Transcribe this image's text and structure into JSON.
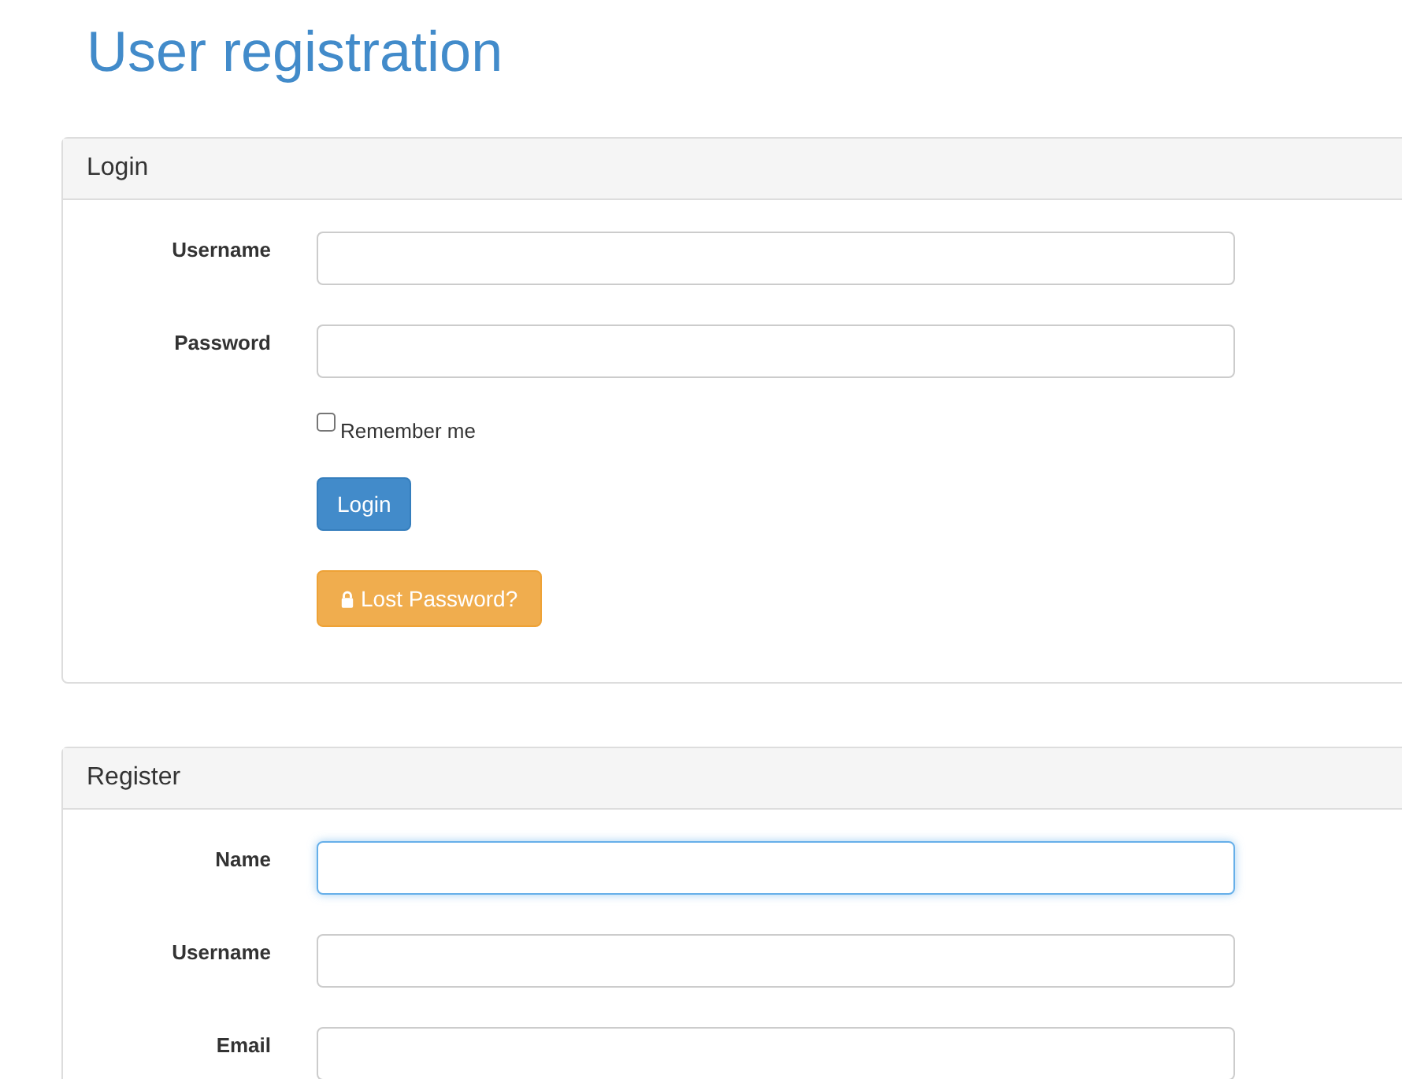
{
  "page_title": "User registration",
  "login": {
    "title": "Login",
    "fields": [
      {
        "label": "Username",
        "focused": false
      },
      {
        "label": "Password",
        "focused": false
      }
    ],
    "remember": {
      "label": "Remember me",
      "checked": false
    },
    "buttons": [
      {
        "label": "Login",
        "kind": "primary"
      },
      {
        "label": "Lost Password?",
        "kind": "warning"
      }
    ]
  },
  "register": {
    "title": "Register",
    "fields": [
      {
        "label": "Name",
        "focused": true
      },
      {
        "label": "Username",
        "focused": false
      },
      {
        "label": "Email",
        "focused": false
      }
    ]
  }
}
